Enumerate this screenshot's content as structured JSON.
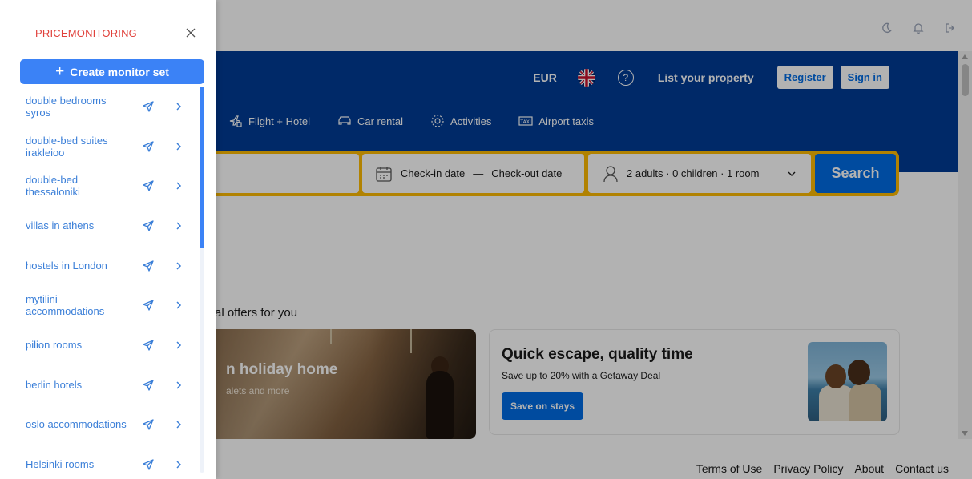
{
  "panel": {
    "title": "PRICEMONITORING",
    "create_label": "Create monitor set",
    "items": [
      {
        "line1": "double bedrooms",
        "line2": "syros"
      },
      {
        "line1": "double-bed suites",
        "line2": "irakleioo"
      },
      {
        "line1": "double-bed",
        "line2": "thessaloniki"
      },
      {
        "line1": "villas in athens",
        "line2": ""
      },
      {
        "line1": "hostels in London",
        "line2": ""
      },
      {
        "line1": "mytilini",
        "line2": "accommodations"
      },
      {
        "line1": "pilion rooms",
        "line2": ""
      },
      {
        "line1": "berlin hotels",
        "line2": ""
      },
      {
        "line1": "oslo accommodations",
        "line2": ""
      },
      {
        "line1": "Helsinki rooms",
        "line2": ""
      }
    ]
  },
  "appbar": {
    "icons": [
      "moon-icon",
      "bell-icon",
      "logout-icon"
    ]
  },
  "booking": {
    "currency": "EUR",
    "list_property": "List your property",
    "register": "Register",
    "sign_in": "Sign in",
    "nav": [
      {
        "label": "Flight + Hotel",
        "icon": "flight-hotel-icon"
      },
      {
        "label": "Car rental",
        "icon": "car-icon"
      },
      {
        "label": "Activities",
        "icon": "activities-icon"
      },
      {
        "label": "Airport taxis",
        "icon": "taxi-icon"
      }
    ],
    "dates_label": "Check-in date",
    "dates_sep": "—",
    "dates_label2": "Check-out date",
    "guests_label": "2 adults · 0 children · 1 room",
    "search_label": "Search",
    "offers_title": "al offers for you",
    "card1_title": "n holiday home",
    "card1_sub": "alets and more",
    "card2_title": "Quick escape, quality time",
    "card2_sub": "Save up to 20% with a Getaway Deal",
    "card2_btn": "Save on stays"
  },
  "footer": {
    "links": [
      "Terms of Use",
      "Privacy Policy",
      "About",
      "Contact us"
    ]
  },
  "colors": {
    "brand_blue": "#003b95",
    "accent_yellow": "#febb02",
    "button_blue": "#006ce4",
    "panel_accent": "#3b82f6",
    "title_red": "#e0413b"
  }
}
